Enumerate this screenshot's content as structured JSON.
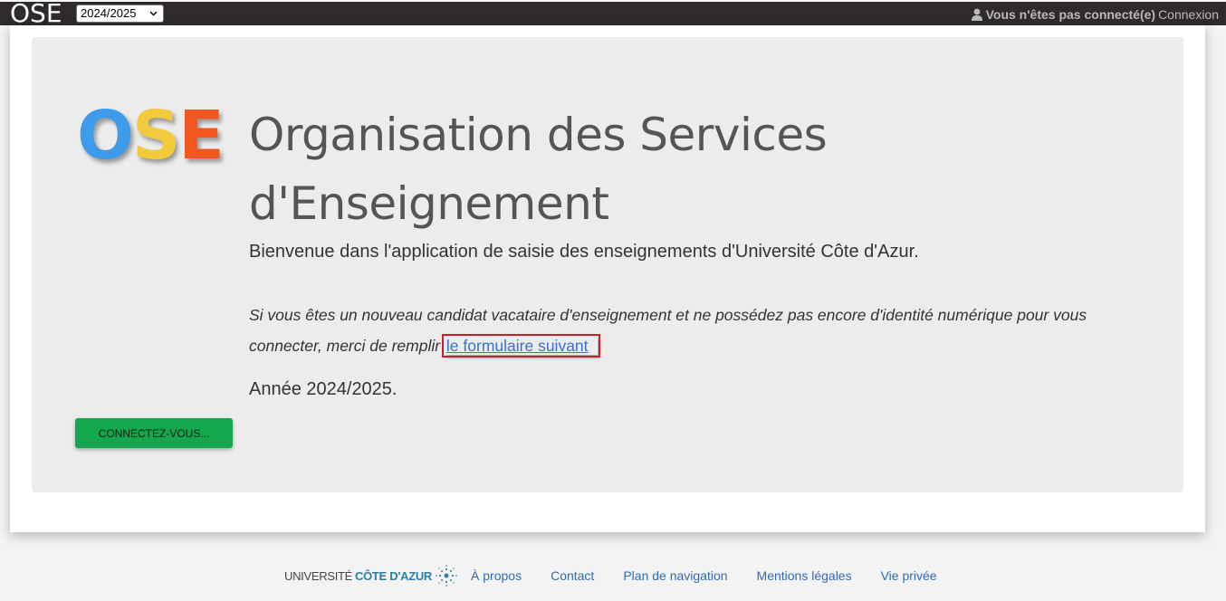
{
  "header": {
    "brand": "OSE",
    "year_selected": "2024/2025",
    "user_status": "Vous n'êtes pas connecté(e)",
    "login_link": "Connexion"
  },
  "hero": {
    "logo_letters": [
      "O",
      "S",
      "E"
    ],
    "title_line1": "Organisation des Services",
    "title_line2": "d'Enseignement",
    "welcome": "Bienvenue dans l'application de saisie des enseignements d'Université Côte d'Azur.",
    "notice_prefix": "Si vous êtes un nouveau candidat vacataire d'enseignement et ne possédez pas encore d'identité numérique pour vous connecter, merci de remplir ",
    "notice_link": "le formulaire suivant",
    "year_label": "Année 2024/2025.",
    "connect_button": "CONNECTEZ-VOUS..."
  },
  "footer": {
    "university_prefix": "UNIVERSITÉ",
    "university_name": "CÔTE D'AZUR",
    "links": [
      "À propos",
      "Contact",
      "Plan de navigation",
      "Mentions légales",
      "Vie privée"
    ]
  },
  "colors": {
    "topbar_bg": "#302b2b",
    "jumbotron_bg": "#ececec",
    "logo_o": "#3d9be9",
    "logo_s": "#f2cb3c",
    "logo_e": "#f1571f",
    "connect_button": "#13a84b",
    "link": "#2f6bb3",
    "highlight_border": "#c8202a"
  },
  "icons": [
    "user-icon",
    "chevron-down-icon",
    "uca-logo-mark"
  ]
}
